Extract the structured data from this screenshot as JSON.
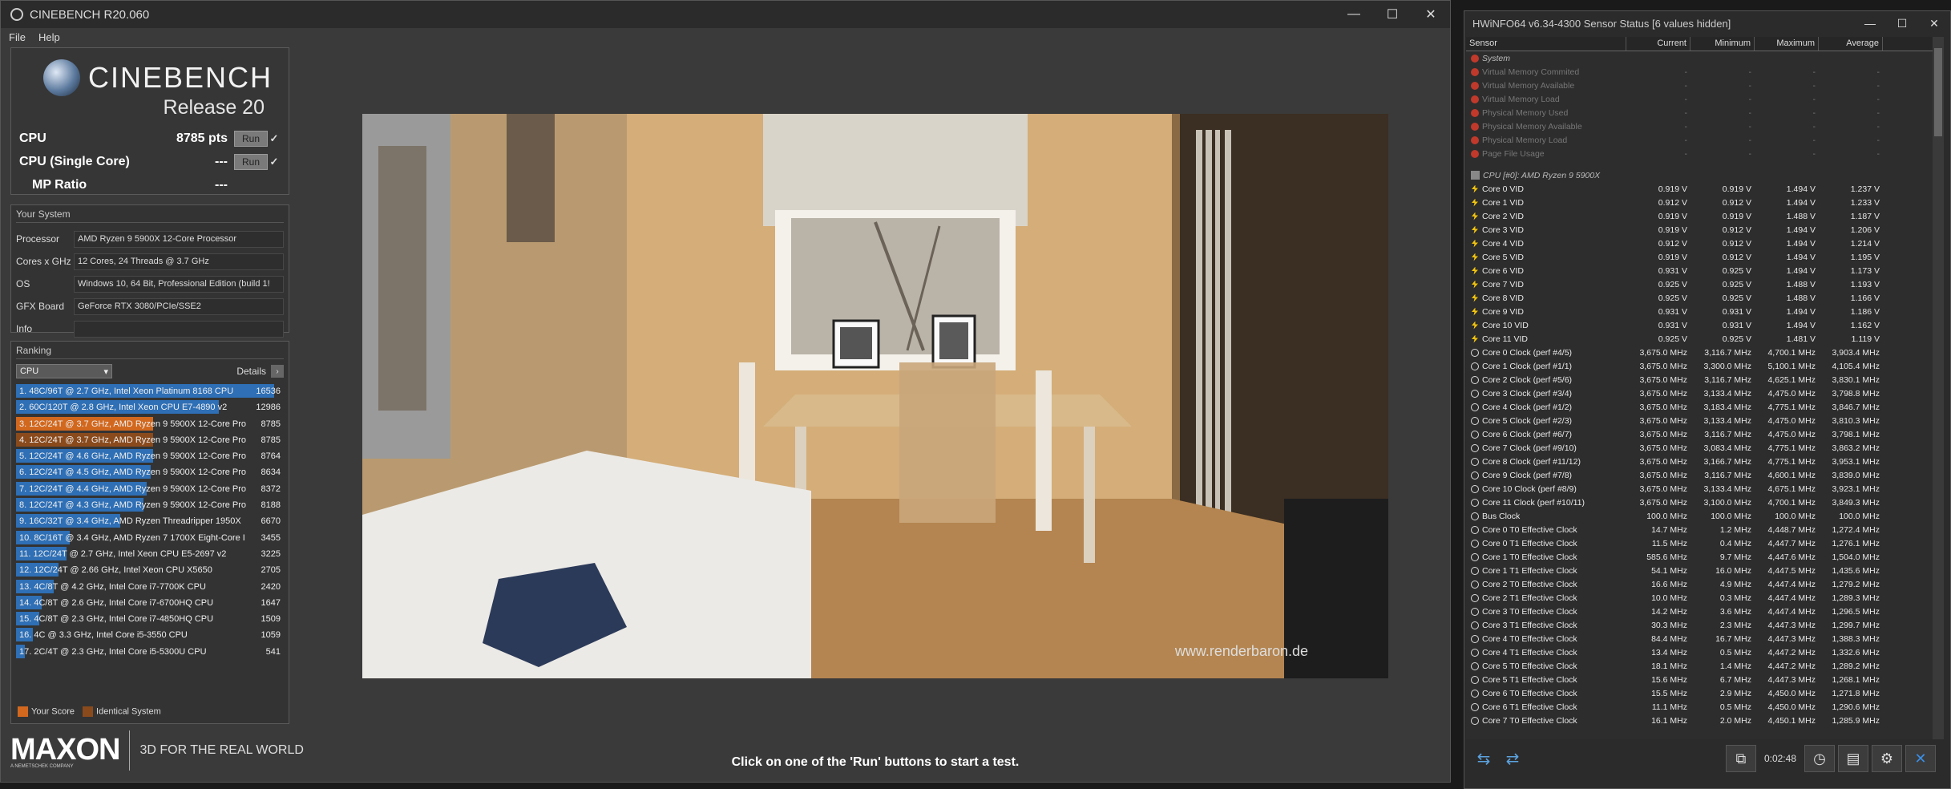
{
  "cinebench": {
    "window_title": "CINEBENCH R20.060",
    "menu": [
      "File",
      "Help"
    ],
    "logo_text": "CINEBENCH",
    "release": "Release 20",
    "scores": [
      {
        "label": "CPU",
        "value": "8785 pts",
        "run": "Run",
        "check": "✓"
      },
      {
        "label": "CPU (Single Core)",
        "value": "---",
        "run": "Run",
        "check": "✓"
      },
      {
        "label": "MP Ratio",
        "value": "---"
      }
    ],
    "your_system_title": "Your System",
    "system": [
      {
        "key": "Processor",
        "value": "AMD Ryzen 9 5900X 12-Core Processor"
      },
      {
        "key": "Cores x GHz",
        "value": "12 Cores, 24 Threads @ 3.7 GHz"
      },
      {
        "key": "OS",
        "value": "Windows 10, 64 Bit, Professional Edition (build 1!"
      },
      {
        "key": "GFX Board",
        "value": "GeForce RTX 3080/PCIe/SSE2"
      },
      {
        "key": "Info",
        "value": ""
      }
    ],
    "ranking_title": "Ranking",
    "ranking_select": "CPU",
    "details_label": "Details",
    "ranking": [
      {
        "name": "1. 48C/96T @ 2.7 GHz, Intel Xeon Platinum 8168 CPU",
        "score": "16536",
        "value": 16536,
        "type": "other"
      },
      {
        "name": "2. 60C/120T @ 2.8 GHz, Intel Xeon CPU E7-4890 v2",
        "score": "12986",
        "value": 12986,
        "type": "other"
      },
      {
        "name": "3. 12C/24T @ 3.7 GHz, AMD Ryzen 9 5900X 12-Core Pro",
        "score": "8785",
        "value": 8785,
        "type": "yours"
      },
      {
        "name": "4. 12C/24T @ 3.7 GHz, AMD Ryzen 9 5900X 12-Core Pro",
        "score": "8785",
        "value": 8785,
        "type": "identical"
      },
      {
        "name": "5. 12C/24T @ 4.6 GHz, AMD Ryzen 9 5900X 12-Core Pro",
        "score": "8764",
        "value": 8764,
        "type": "other"
      },
      {
        "name": "6. 12C/24T @ 4.5 GHz, AMD Ryzen 9 5900X 12-Core Pro",
        "score": "8634",
        "value": 8634,
        "type": "other"
      },
      {
        "name": "7. 12C/24T @ 4.4 GHz, AMD Ryzen 9 5900X 12-Core Pro",
        "score": "8372",
        "value": 8372,
        "type": "other"
      },
      {
        "name": "8. 12C/24T @ 4.3 GHz, AMD Ryzen 9 5900X 12-Core Pro",
        "score": "8188",
        "value": 8188,
        "type": "other"
      },
      {
        "name": "9. 16C/32T @ 3.4 GHz, AMD Ryzen Threadripper 1950X",
        "score": "6670",
        "value": 6670,
        "type": "other"
      },
      {
        "name": "10. 8C/16T @ 3.4 GHz, AMD Ryzen 7 1700X Eight-Core I",
        "score": "3455",
        "value": 3455,
        "type": "other"
      },
      {
        "name": "11. 12C/24T @ 2.7 GHz, Intel Xeon CPU E5-2697 v2",
        "score": "3225",
        "value": 3225,
        "type": "other"
      },
      {
        "name": "12. 12C/24T @ 2.66 GHz, Intel Xeon CPU X5650",
        "score": "2705",
        "value": 2705,
        "type": "other"
      },
      {
        "name": "13. 4C/8T @ 4.2 GHz, Intel Core i7-7700K CPU",
        "score": "2420",
        "value": 2420,
        "type": "other"
      },
      {
        "name": "14. 4C/8T @ 2.6 GHz, Intel Core i7-6700HQ CPU",
        "score": "1647",
        "value": 1647,
        "type": "other"
      },
      {
        "name": "15. 4C/8T @ 2.3 GHz, Intel Core i7-4850HQ CPU",
        "score": "1509",
        "value": 1509,
        "type": "other"
      },
      {
        "name": "16. 4C @ 3.3 GHz, Intel Core i5-3550 CPU",
        "score": "1059",
        "value": 1059,
        "type": "other"
      },
      {
        "name": "17. 2C/4T @ 2.3 GHz, Intel Core i5-5300U CPU",
        "score": "541",
        "value": 541,
        "type": "other"
      }
    ],
    "legend_yours": "Your Score",
    "legend_identical": "Identical System",
    "colors": {
      "bar_other": "#2e6fb5",
      "bar_yours": "#d2681e",
      "bar_identical": "#8a4a1c"
    },
    "maxon_logo": "MAXON",
    "maxon_sub": "A NEMETSCHEK COMPANY",
    "tagline": "3D FOR THE REAL WORLD",
    "render_watermark": "www.renderbaron.de",
    "status": "Click on one of the 'Run' buttons to start a test."
  },
  "hwinfo": {
    "window_title": "HWiNFO64 v6.34-4300 Sensor Status [6 values hidden]",
    "columns": [
      "Sensor",
      "Current",
      "Minimum",
      "Maximum",
      "Average"
    ],
    "rows": [
      {
        "icon": "x",
        "name": "System",
        "cur": "",
        "min": "",
        "max": "",
        "avg": "",
        "style": "grp-dim"
      },
      {
        "icon": "x",
        "name": "Virtual Memory Commited",
        "cur": "-",
        "min": "-",
        "max": "-",
        "avg": "-",
        "style": "dim"
      },
      {
        "icon": "x",
        "name": "Virtual Memory Available",
        "cur": "-",
        "min": "-",
        "max": "-",
        "avg": "-",
        "style": "dim"
      },
      {
        "icon": "x",
        "name": "Virtual Memory Load",
        "cur": "-",
        "min": "-",
        "max": "-",
        "avg": "-",
        "style": "dim"
      },
      {
        "icon": "x",
        "name": "Physical Memory Used",
        "cur": "-",
        "min": "-",
        "max": "-",
        "avg": "-",
        "style": "dim"
      },
      {
        "icon": "x",
        "name": "Physical Memory Available",
        "cur": "-",
        "min": "-",
        "max": "-",
        "avg": "-",
        "style": "dim"
      },
      {
        "icon": "x",
        "name": "Physical Memory Load",
        "cur": "-",
        "min": "-",
        "max": "-",
        "avg": "-",
        "style": "dim"
      },
      {
        "icon": "x",
        "name": "Page File Usage",
        "cur": "-",
        "min": "-",
        "max": "-",
        "avg": "-",
        "style": "dim"
      },
      {
        "icon": "spacer"
      },
      {
        "icon": "cpu",
        "name": "CPU [#0]: AMD Ryzen 9 5900X",
        "cur": "",
        "min": "",
        "max": "",
        "avg": "",
        "style": "grp"
      },
      {
        "icon": "volt",
        "name": "Core 0 VID",
        "cur": "0.919 V",
        "min": "0.919 V",
        "max": "1.494 V",
        "avg": "1.237 V"
      },
      {
        "icon": "volt",
        "name": "Core 1 VID",
        "cur": "0.912 V",
        "min": "0.912 V",
        "max": "1.494 V",
        "avg": "1.233 V"
      },
      {
        "icon": "volt",
        "name": "Core 2 VID",
        "cur": "0.919 V",
        "min": "0.919 V",
        "max": "1.488 V",
        "avg": "1.187 V"
      },
      {
        "icon": "volt",
        "name": "Core 3 VID",
        "cur": "0.919 V",
        "min": "0.912 V",
        "max": "1.494 V",
        "avg": "1.206 V"
      },
      {
        "icon": "volt",
        "name": "Core 4 VID",
        "cur": "0.912 V",
        "min": "0.912 V",
        "max": "1.494 V",
        "avg": "1.214 V"
      },
      {
        "icon": "volt",
        "name": "Core 5 VID",
        "cur": "0.919 V",
        "min": "0.912 V",
        "max": "1.494 V",
        "avg": "1.195 V"
      },
      {
        "icon": "volt",
        "name": "Core 6 VID",
        "cur": "0.931 V",
        "min": "0.925 V",
        "max": "1.494 V",
        "avg": "1.173 V"
      },
      {
        "icon": "volt",
        "name": "Core 7 VID",
        "cur": "0.925 V",
        "min": "0.925 V",
        "max": "1.488 V",
        "avg": "1.193 V"
      },
      {
        "icon": "volt",
        "name": "Core 8 VID",
        "cur": "0.925 V",
        "min": "0.925 V",
        "max": "1.488 V",
        "avg": "1.166 V"
      },
      {
        "icon": "volt",
        "name": "Core 9 VID",
        "cur": "0.931 V",
        "min": "0.931 V",
        "max": "1.494 V",
        "avg": "1.186 V"
      },
      {
        "icon": "volt",
        "name": "Core 10 VID",
        "cur": "0.931 V",
        "min": "0.931 V",
        "max": "1.494 V",
        "avg": "1.162 V"
      },
      {
        "icon": "volt",
        "name": "Core 11 VID",
        "cur": "0.925 V",
        "min": "0.925 V",
        "max": "1.481 V",
        "avg": "1.119 V"
      },
      {
        "icon": "clock",
        "name": "Core 0 Clock (perf #4/5)",
        "cur": "3,675.0 MHz",
        "min": "3,116.7 MHz",
        "max": "4,700.1 MHz",
        "avg": "3,903.4 MHz"
      },
      {
        "icon": "clock",
        "name": "Core 1 Clock (perf #1/1)",
        "cur": "3,675.0 MHz",
        "min": "3,300.0 MHz",
        "max": "5,100.1 MHz",
        "avg": "4,105.4 MHz"
      },
      {
        "icon": "clock",
        "name": "Core 2 Clock (perf #5/6)",
        "cur": "3,675.0 MHz",
        "min": "3,116.7 MHz",
        "max": "4,625.1 MHz",
        "avg": "3,830.1 MHz"
      },
      {
        "icon": "clock",
        "name": "Core 3 Clock (perf #3/4)",
        "cur": "3,675.0 MHz",
        "min": "3,133.4 MHz",
        "max": "4,475.0 MHz",
        "avg": "3,798.8 MHz"
      },
      {
        "icon": "clock",
        "name": "Core 4 Clock (perf #1/2)",
        "cur": "3,675.0 MHz",
        "min": "3,183.4 MHz",
        "max": "4,775.1 MHz",
        "avg": "3,846.7 MHz"
      },
      {
        "icon": "clock",
        "name": "Core 5 Clock (perf #2/3)",
        "cur": "3,675.0 MHz",
        "min": "3,133.4 MHz",
        "max": "4,475.0 MHz",
        "avg": "3,810.3 MHz"
      },
      {
        "icon": "clock",
        "name": "Core 6 Clock (perf #6/7)",
        "cur": "3,675.0 MHz",
        "min": "3,116.7 MHz",
        "max": "4,475.0 MHz",
        "avg": "3,798.1 MHz"
      },
      {
        "icon": "clock",
        "name": "Core 7 Clock (perf #9/10)",
        "cur": "3,675.0 MHz",
        "min": "3,083.4 MHz",
        "max": "4,775.1 MHz",
        "avg": "3,863.2 MHz"
      },
      {
        "icon": "clock",
        "name": "Core 8 Clock (perf #11/12)",
        "cur": "3,675.0 MHz",
        "min": "3,166.7 MHz",
        "max": "4,775.1 MHz",
        "avg": "3,953.1 MHz"
      },
      {
        "icon": "clock",
        "name": "Core 9 Clock (perf #7/8)",
        "cur": "3,675.0 MHz",
        "min": "3,116.7 MHz",
        "max": "4,600.1 MHz",
        "avg": "3,839.0 MHz"
      },
      {
        "icon": "clock",
        "name": "Core 10 Clock (perf #8/9)",
        "cur": "3,675.0 MHz",
        "min": "3,133.4 MHz",
        "max": "4,675.1 MHz",
        "avg": "3,923.1 MHz"
      },
      {
        "icon": "clock",
        "name": "Core 11 Clock (perf #10/11)",
        "cur": "3,675.0 MHz",
        "min": "3,100.0 MHz",
        "max": "4,700.1 MHz",
        "avg": "3,849.3 MHz"
      },
      {
        "icon": "clock",
        "name": "Bus Clock",
        "cur": "100.0 MHz",
        "min": "100.0 MHz",
        "max": "100.0 MHz",
        "avg": "100.0 MHz"
      },
      {
        "icon": "clock",
        "name": "Core 0 T0 Effective Clock",
        "cur": "14.7 MHz",
        "min": "1.2 MHz",
        "max": "4,448.7 MHz",
        "avg": "1,272.4 MHz"
      },
      {
        "icon": "clock",
        "name": "Core 0 T1 Effective Clock",
        "cur": "11.5 MHz",
        "min": "0.4 MHz",
        "max": "4,447.7 MHz",
        "avg": "1,276.1 MHz"
      },
      {
        "icon": "clock",
        "name": "Core 1 T0 Effective Clock",
        "cur": "585.6 MHz",
        "min": "9.7 MHz",
        "max": "4,447.6 MHz",
        "avg": "1,504.0 MHz"
      },
      {
        "icon": "clock",
        "name": "Core 1 T1 Effective Clock",
        "cur": "54.1 MHz",
        "min": "16.0 MHz",
        "max": "4,447.5 MHz",
        "avg": "1,435.6 MHz"
      },
      {
        "icon": "clock",
        "name": "Core 2 T0 Effective Clock",
        "cur": "16.6 MHz",
        "min": "4.9 MHz",
        "max": "4,447.4 MHz",
        "avg": "1,279.2 MHz"
      },
      {
        "icon": "clock",
        "name": "Core 2 T1 Effective Clock",
        "cur": "10.0 MHz",
        "min": "0.3 MHz",
        "max": "4,447.4 MHz",
        "avg": "1,289.3 MHz"
      },
      {
        "icon": "clock",
        "name": "Core 3 T0 Effective Clock",
        "cur": "14.2 MHz",
        "min": "3.6 MHz",
        "max": "4,447.4 MHz",
        "avg": "1,296.5 MHz"
      },
      {
        "icon": "clock",
        "name": "Core 3 T1 Effective Clock",
        "cur": "30.3 MHz",
        "min": "2.3 MHz",
        "max": "4,447.3 MHz",
        "avg": "1,299.7 MHz"
      },
      {
        "icon": "clock",
        "name": "Core 4 T0 Effective Clock",
        "cur": "84.4 MHz",
        "min": "16.7 MHz",
        "max": "4,447.3 MHz",
        "avg": "1,388.3 MHz"
      },
      {
        "icon": "clock",
        "name": "Core 4 T1 Effective Clock",
        "cur": "13.4 MHz",
        "min": "0.5 MHz",
        "max": "4,447.2 MHz",
        "avg": "1,332.6 MHz"
      },
      {
        "icon": "clock",
        "name": "Core 5 T0 Effective Clock",
        "cur": "18.1 MHz",
        "min": "1.4 MHz",
        "max": "4,447.2 MHz",
        "avg": "1,289.2 MHz"
      },
      {
        "icon": "clock",
        "name": "Core 5 T1 Effective Clock",
        "cur": "15.6 MHz",
        "min": "6.7 MHz",
        "max": "4,447.3 MHz",
        "avg": "1,268.1 MHz"
      },
      {
        "icon": "clock",
        "name": "Core 6 T0 Effective Clock",
        "cur": "15.5 MHz",
        "min": "2.9 MHz",
        "max": "4,450.0 MHz",
        "avg": "1,271.8 MHz"
      },
      {
        "icon": "clock",
        "name": "Core 6 T1 Effective Clock",
        "cur": "11.1 MHz",
        "min": "0.5 MHz",
        "max": "4,450.0 MHz",
        "avg": "1,290.6 MHz"
      },
      {
        "icon": "clock",
        "name": "Core 7 T0 Effective Clock",
        "cur": "16.1 MHz",
        "min": "2.0 MHz",
        "max": "4,450.1 MHz",
        "avg": "1,285.9 MHz"
      }
    ],
    "toolbar_time": "0:02:48"
  }
}
